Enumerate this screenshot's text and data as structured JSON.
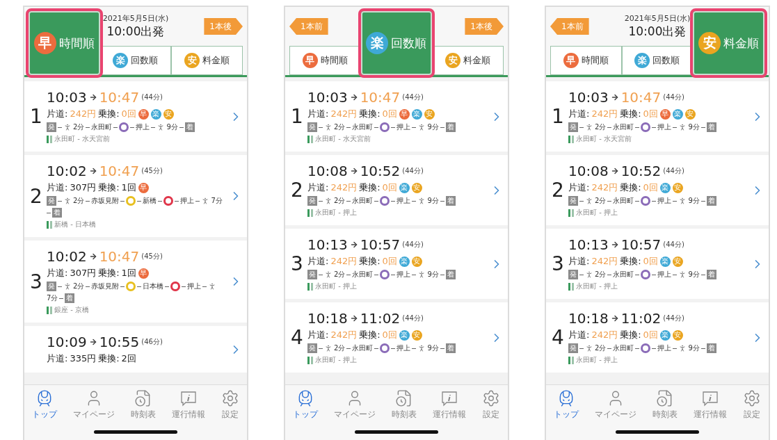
{
  "screens": [
    {
      "header": {
        "date": "2021年5月5日(水)",
        "time": "10:00出発",
        "next": "1本後"
      },
      "sort_tabs": [
        {
          "badge": "早",
          "label": "時間順",
          "color": "#ec6c3e",
          "selected": true
        },
        {
          "badge": "楽",
          "label": "回数順",
          "color": "#3fa9d6",
          "selected": false
        },
        {
          "badge": "安",
          "label": "料金順",
          "color": "#eaa520",
          "selected": false
        }
      ],
      "routes": [
        {
          "number": "1",
          "depart": "10:03",
          "arrive": "10:47",
          "arrive_highlight": true,
          "duration": "(44分)",
          "fare_label": "片道:",
          "fare": "242円",
          "fare_highlight": true,
          "transfer_label": "乗換:",
          "transfers": "0回",
          "transfers_highlight": true,
          "badges": [
            {
              "text": "早",
              "color": "#ec6c3e"
            },
            {
              "text": "楽",
              "color": "#3fa9d6"
            },
            {
              "text": "安",
              "color": "#eaa520"
            }
          ],
          "route": [
            {
              "kind": "start",
              "text": "発"
            },
            {
              "kind": "walk",
              "text": "2分"
            },
            {
              "kind": "station",
              "text": "永田町"
            },
            {
              "kind": "line",
              "color": "#8b6cb8"
            },
            {
              "kind": "station",
              "text": "押上"
            },
            {
              "kind": "walk",
              "text": "9分"
            },
            {
              "kind": "end",
              "text": "着"
            }
          ],
          "via": "永田町 - 水天宮前"
        },
        {
          "number": "2",
          "depart": "10:02",
          "arrive": "10:47",
          "arrive_highlight": true,
          "duration": "(45分)",
          "fare_label": "片道:",
          "fare": "307円",
          "fare_highlight": false,
          "transfer_label": "乗換:",
          "transfers": "1回",
          "transfers_highlight": false,
          "badges": [
            {
              "text": "早",
              "color": "#ec6c3e"
            }
          ],
          "route": [
            {
              "kind": "start",
              "text": "発"
            },
            {
              "kind": "walk",
              "text": "2分"
            },
            {
              "kind": "station",
              "text": "赤坂見附"
            },
            {
              "kind": "line",
              "color": "#e8c020"
            },
            {
              "kind": "station",
              "text": "新橋"
            },
            {
              "kind": "line",
              "color": "#e0364a"
            },
            {
              "kind": "station",
              "text": "押上"
            },
            {
              "kind": "walk",
              "text": "7分"
            },
            {
              "kind": "end",
              "text": "着"
            }
          ],
          "via": "新橋 - 日本橋"
        },
        {
          "number": "3",
          "depart": "10:02",
          "arrive": "10:47",
          "arrive_highlight": true,
          "duration": "(45分)",
          "fare_label": "片道:",
          "fare": "307円",
          "fare_highlight": false,
          "transfer_label": "乗換:",
          "transfers": "1回",
          "transfers_highlight": false,
          "badges": [
            {
              "text": "早",
              "color": "#ec6c3e"
            }
          ],
          "route": [
            {
              "kind": "start",
              "text": "発"
            },
            {
              "kind": "walk",
              "text": "2分"
            },
            {
              "kind": "station",
              "text": "赤坂見附"
            },
            {
              "kind": "line",
              "color": "#e8c020"
            },
            {
              "kind": "station",
              "text": "日本橋"
            },
            {
              "kind": "line",
              "color": "#e0364a"
            },
            {
              "kind": "station",
              "text": "押上"
            },
            {
              "kind": "walk",
              "text": "7分"
            },
            {
              "kind": "end",
              "text": "着"
            }
          ],
          "via": "銀座 - 京橋"
        },
        {
          "depart": "10:09",
          "arrive": "10:55",
          "arrive_highlight": false,
          "duration": "(46分)",
          "fare_label": "片道:",
          "fare": "335円",
          "fare_highlight": false,
          "transfer_label": "乗換:",
          "transfers": "2回",
          "transfers_highlight": false
        }
      ],
      "tab_bar": [
        {
          "kind": "train",
          "label": "トップ",
          "selected": true
        },
        {
          "kind": "person",
          "label": "マイページ",
          "selected": false
        },
        {
          "kind": "timetable",
          "label": "時刻表",
          "selected": false
        },
        {
          "kind": "info",
          "label": "運行情報",
          "selected": false
        },
        {
          "kind": "settings",
          "label": "設定",
          "selected": false
        }
      ]
    },
    {
      "header": {
        "prev": "1本前",
        "next": "1本後"
      },
      "sort_tabs": [
        {
          "badge": "早",
          "label": "時間順",
          "color": "#ec6c3e",
          "selected": false
        },
        {
          "badge": "楽",
          "label": "回数順",
          "color": "#3fa9d6",
          "selected": true
        },
        {
          "badge": "安",
          "label": "料金順",
          "color": "#eaa520",
          "selected": false
        }
      ],
      "routes": [
        {
          "number": "1",
          "depart": "10:03",
          "arrive": "10:47",
          "arrive_highlight": true,
          "duration": "(44分)",
          "fare_label": "片道:",
          "fare": "242円",
          "fare_highlight": true,
          "transfer_label": "乗換:",
          "transfers": "0回",
          "transfers_highlight": true,
          "badges": [
            {
              "text": "早",
              "color": "#ec6c3e"
            },
            {
              "text": "楽",
              "color": "#3fa9d6"
            },
            {
              "text": "安",
              "color": "#eaa520"
            }
          ],
          "route": [
            {
              "kind": "start",
              "text": "発"
            },
            {
              "kind": "walk",
              "text": "2分"
            },
            {
              "kind": "station",
              "text": "永田町"
            },
            {
              "kind": "line",
              "color": "#8b6cb8"
            },
            {
              "kind": "station",
              "text": "押上"
            },
            {
              "kind": "walk",
              "text": "9分"
            },
            {
              "kind": "end",
              "text": "着"
            }
          ],
          "via": "永田町 - 水天宮前"
        },
        {
          "number": "2",
          "depart": "10:08",
          "arrive": "10:52",
          "arrive_highlight": false,
          "duration": "(44分)",
          "fare_label": "片道:",
          "fare": "242円",
          "fare_highlight": true,
          "transfer_label": "乗換:",
          "transfers": "0回",
          "transfers_highlight": true,
          "badges": [
            {
              "text": "楽",
              "color": "#3fa9d6"
            },
            {
              "text": "安",
              "color": "#eaa520"
            }
          ],
          "route": [
            {
              "kind": "start",
              "text": "発"
            },
            {
              "kind": "walk",
              "text": "2分"
            },
            {
              "kind": "station",
              "text": "永田町"
            },
            {
              "kind": "line",
              "color": "#8b6cb8"
            },
            {
              "kind": "station",
              "text": "押上"
            },
            {
              "kind": "walk",
              "text": "9分"
            },
            {
              "kind": "end",
              "text": "着"
            }
          ],
          "via": "永田町 - 押上"
        },
        {
          "number": "3",
          "depart": "10:13",
          "arrive": "10:57",
          "arrive_highlight": false,
          "duration": "(44分)",
          "fare_label": "片道:",
          "fare": "242円",
          "fare_highlight": true,
          "transfer_label": "乗換:",
          "transfers": "0回",
          "transfers_highlight": true,
          "badges": [
            {
              "text": "楽",
              "color": "#3fa9d6"
            },
            {
              "text": "安",
              "color": "#eaa520"
            }
          ],
          "route": [
            {
              "kind": "start",
              "text": "発"
            },
            {
              "kind": "walk",
              "text": "2分"
            },
            {
              "kind": "station",
              "text": "永田町"
            },
            {
              "kind": "line",
              "color": "#8b6cb8"
            },
            {
              "kind": "station",
              "text": "押上"
            },
            {
              "kind": "walk",
              "text": "9分"
            },
            {
              "kind": "end",
              "text": "着"
            }
          ],
          "via": "永田町 - 押上"
        },
        {
          "number": "4",
          "depart": "10:18",
          "arrive": "11:02",
          "arrive_highlight": false,
          "duration": "(44分)",
          "fare_label": "片道:",
          "fare": "242円",
          "fare_highlight": true,
          "transfer_label": "乗換:",
          "transfers": "0回",
          "transfers_highlight": true,
          "badges": [
            {
              "text": "楽",
              "color": "#3fa9d6"
            },
            {
              "text": "安",
              "color": "#eaa520"
            }
          ],
          "route": [
            {
              "kind": "start",
              "text": "発"
            },
            {
              "kind": "walk",
              "text": "2分"
            },
            {
              "kind": "station",
              "text": "永田町"
            },
            {
              "kind": "line",
              "color": "#8b6cb8"
            },
            {
              "kind": "station",
              "text": "押上"
            },
            {
              "kind": "walk",
              "text": "9分"
            },
            {
              "kind": "end",
              "text": "着"
            }
          ],
          "via": "永田町 - 押上"
        }
      ],
      "tab_bar": [
        {
          "kind": "train",
          "label": "トップ",
          "selected": true
        },
        {
          "kind": "person",
          "label": "マイページ",
          "selected": false
        },
        {
          "kind": "timetable",
          "label": "時刻表",
          "selected": false
        },
        {
          "kind": "info",
          "label": "運行情報",
          "selected": false
        },
        {
          "kind": "settings",
          "label": "設定",
          "selected": false
        }
      ]
    },
    {
      "header": {
        "prev": "1本前",
        "date": "2021年5月5日(水)",
        "time": "10:00出発"
      },
      "sort_tabs": [
        {
          "badge": "早",
          "label": "時間順",
          "color": "#ec6c3e",
          "selected": false
        },
        {
          "badge": "楽",
          "label": "回数順",
          "color": "#3fa9d6",
          "selected": false
        },
        {
          "badge": "安",
          "label": "料金順",
          "color": "#eaa520",
          "selected": true
        }
      ],
      "routes": [
        {
          "number": "1",
          "depart": "10:03",
          "arrive": "10:47",
          "arrive_highlight": true,
          "duration": "(44分)",
          "fare_label": "片道:",
          "fare": "242円",
          "fare_highlight": true,
          "transfer_label": "乗換:",
          "transfers": "0回",
          "transfers_highlight": true,
          "badges": [
            {
              "text": "早",
              "color": "#ec6c3e"
            },
            {
              "text": "楽",
              "color": "#3fa9d6"
            },
            {
              "text": "安",
              "color": "#eaa520"
            }
          ],
          "route": [
            {
              "kind": "start",
              "text": "発"
            },
            {
              "kind": "walk",
              "text": "2分"
            },
            {
              "kind": "station",
              "text": "永田町"
            },
            {
              "kind": "line",
              "color": "#8b6cb8"
            },
            {
              "kind": "station",
              "text": "押上"
            },
            {
              "kind": "walk",
              "text": "9分"
            },
            {
              "kind": "end",
              "text": "着"
            }
          ],
          "via": "永田町 - 水天宮前"
        },
        {
          "number": "2",
          "depart": "10:08",
          "arrive": "10:52",
          "arrive_highlight": false,
          "duration": "(44分)",
          "fare_label": "片道:",
          "fare": "242円",
          "fare_highlight": true,
          "transfer_label": "乗換:",
          "transfers": "0回",
          "transfers_highlight": true,
          "badges": [
            {
              "text": "楽",
              "color": "#3fa9d6"
            },
            {
              "text": "安",
              "color": "#eaa520"
            }
          ],
          "route": [
            {
              "kind": "start",
              "text": "発"
            },
            {
              "kind": "walk",
              "text": "2分"
            },
            {
              "kind": "station",
              "text": "永田町"
            },
            {
              "kind": "line",
              "color": "#8b6cb8"
            },
            {
              "kind": "station",
              "text": "押上"
            },
            {
              "kind": "walk",
              "text": "9分"
            },
            {
              "kind": "end",
              "text": "着"
            }
          ],
          "via": "永田町 - 押上"
        },
        {
          "number": "3",
          "depart": "10:13",
          "arrive": "10:57",
          "arrive_highlight": false,
          "duration": "(44分)",
          "fare_label": "片道:",
          "fare": "242円",
          "fare_highlight": true,
          "transfer_label": "乗換:",
          "transfers": "0回",
          "transfers_highlight": true,
          "badges": [
            {
              "text": "楽",
              "color": "#3fa9d6"
            },
            {
              "text": "安",
              "color": "#eaa520"
            }
          ],
          "route": [
            {
              "kind": "start",
              "text": "発"
            },
            {
              "kind": "walk",
              "text": "2分"
            },
            {
              "kind": "station",
              "text": "永田町"
            },
            {
              "kind": "line",
              "color": "#8b6cb8"
            },
            {
              "kind": "station",
              "text": "押上"
            },
            {
              "kind": "walk",
              "text": "9分"
            },
            {
              "kind": "end",
              "text": "着"
            }
          ],
          "via": "永田町 - 押上"
        },
        {
          "number": "4",
          "depart": "10:18",
          "arrive": "11:02",
          "arrive_highlight": false,
          "duration": "(44分)",
          "fare_label": "片道:",
          "fare": "242円",
          "fare_highlight": true,
          "transfer_label": "乗換:",
          "transfers": "0回",
          "transfers_highlight": true,
          "badges": [
            {
              "text": "楽",
              "color": "#3fa9d6"
            },
            {
              "text": "安",
              "color": "#eaa520"
            }
          ],
          "route": [
            {
              "kind": "start",
              "text": "発"
            },
            {
              "kind": "walk",
              "text": "2分"
            },
            {
              "kind": "station",
              "text": "永田町"
            },
            {
              "kind": "line",
              "color": "#8b6cb8"
            },
            {
              "kind": "station",
              "text": "押上"
            },
            {
              "kind": "walk",
              "text": "9分"
            },
            {
              "kind": "end",
              "text": "着"
            }
          ],
          "via": "永田町 - 押上"
        }
      ],
      "tab_bar": [
        {
          "kind": "train",
          "label": "トップ",
          "selected": true
        },
        {
          "kind": "person",
          "label": "マイページ",
          "selected": false
        },
        {
          "kind": "timetable",
          "label": "時刻表",
          "selected": false
        },
        {
          "kind": "info",
          "label": "運行情報",
          "selected": false
        },
        {
          "kind": "settings",
          "label": "設定",
          "selected": false
        }
      ]
    }
  ]
}
